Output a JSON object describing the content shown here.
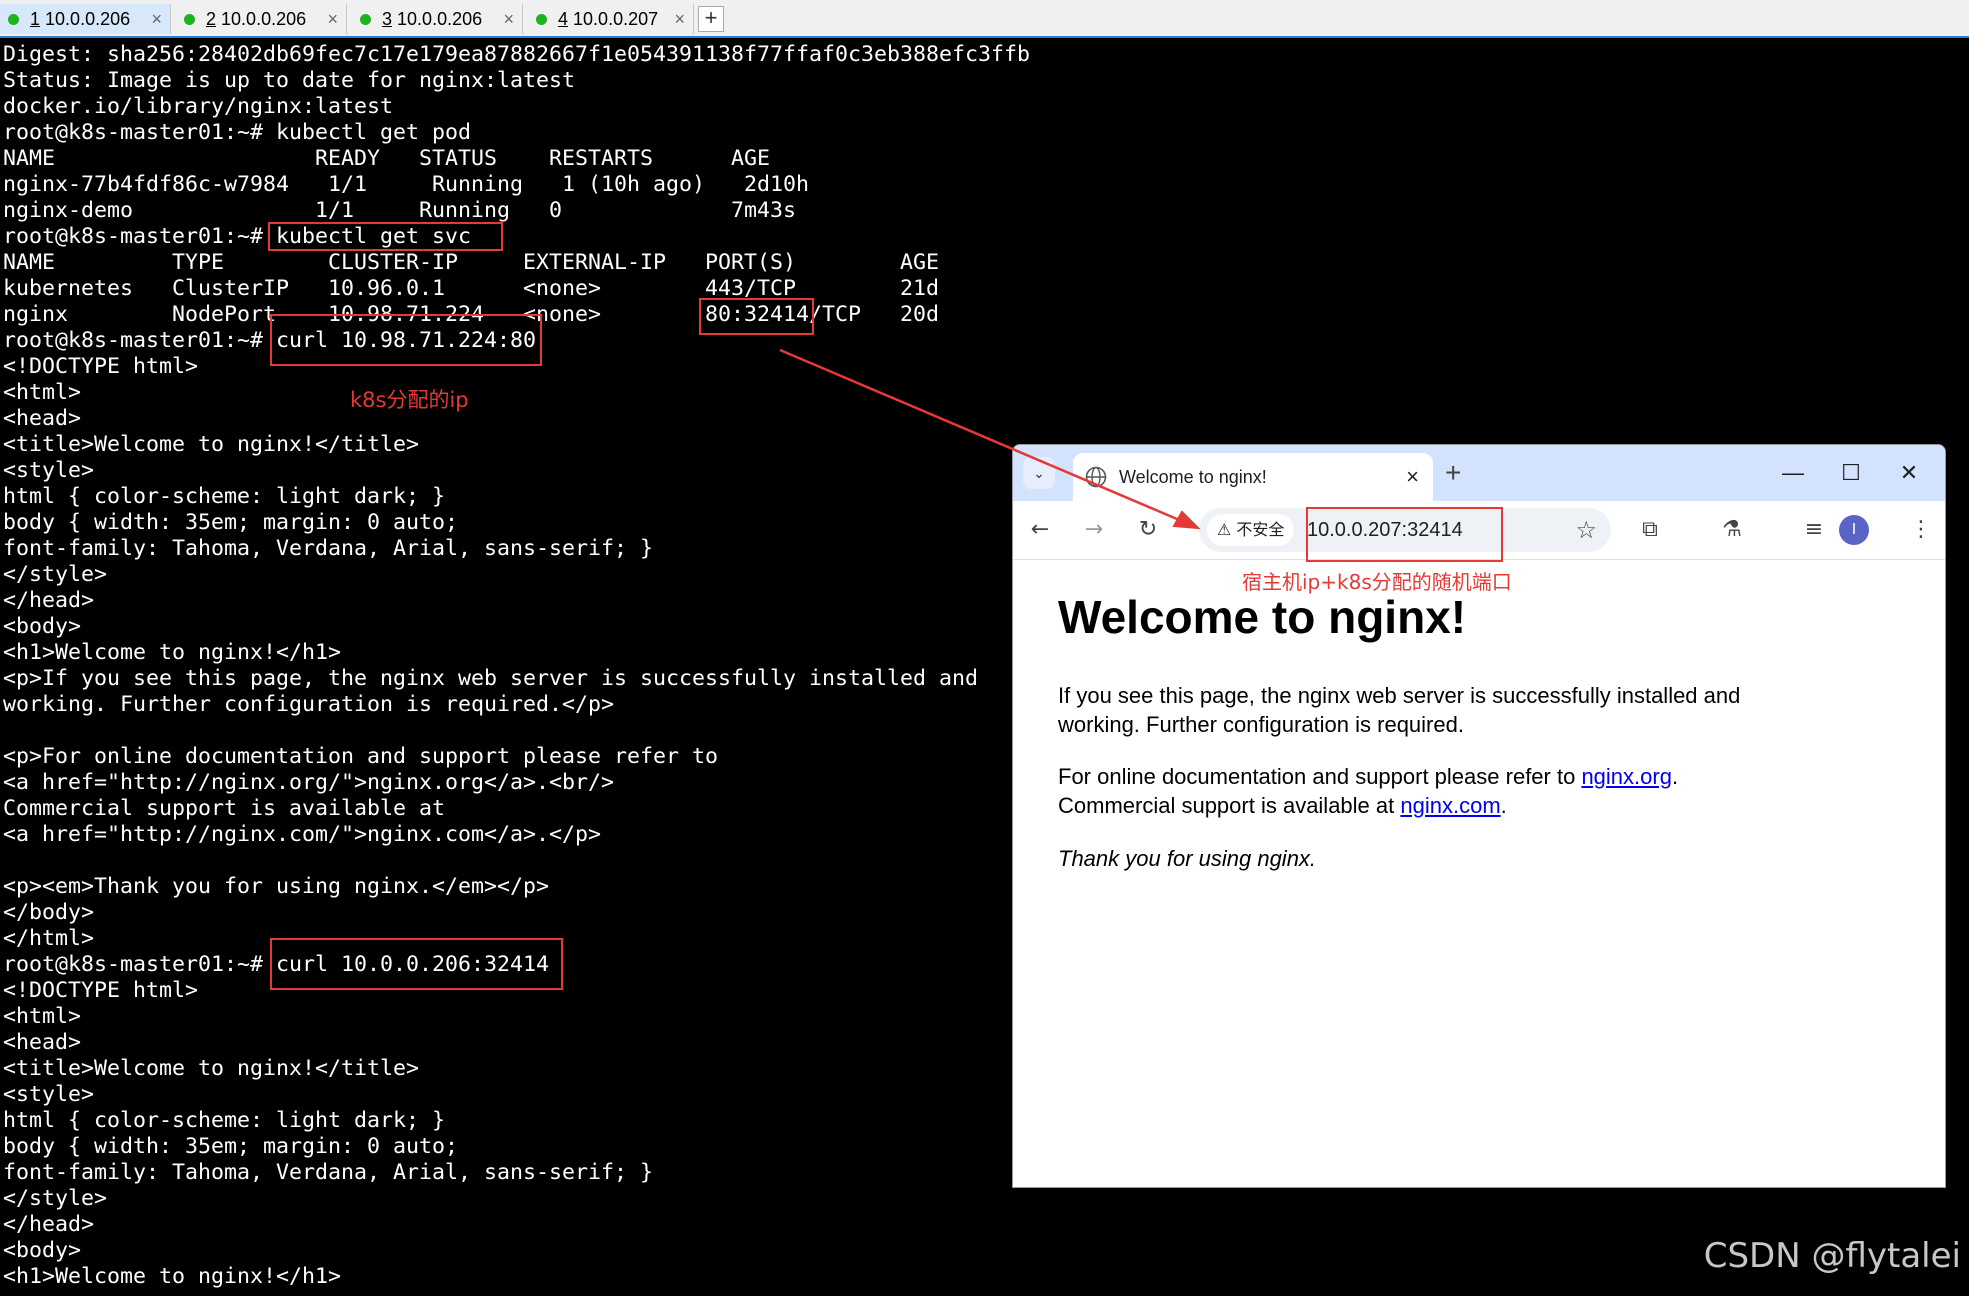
{
  "tabs": [
    {
      "num": "1",
      "host": "10.0.0.206",
      "active": true
    },
    {
      "num": "2",
      "host": "10.0.0.206",
      "active": false
    },
    {
      "num": "3",
      "host": "10.0.0.206",
      "active": false
    },
    {
      "num": "4",
      "host": "10.0.0.207",
      "active": false
    }
  ],
  "tab_close_glyph": "×",
  "tab_add_glyph": "+",
  "terminal": {
    "lines": [
      "Digest: sha256:28402db69fec7c17e179ea87882667f1e054391138f77ffaf0c3eb388efc3ffb",
      "Status: Image is up to date for nginx:latest",
      "docker.io/library/nginx:latest",
      "root@k8s-master01:~# kubectl get pod",
      "NAME                    READY   STATUS    RESTARTS      AGE",
      "nginx-77b4fdf86c-w7984   1/1     Running   1 (10h ago)   2d10h",
      "nginx-demo              1/1     Running   0             7m43s",
      "root@k8s-master01:~# kubectl get svc",
      "NAME         TYPE        CLUSTER-IP     EXTERNAL-IP   PORT(S)        AGE",
      "kubernetes   ClusterIP   10.96.0.1      <none>        443/TCP        21d",
      "nginx        NodePort    10.98.71.224   <none>        80:32414/TCP   20d",
      "root@k8s-master01:~# curl 10.98.71.224:80",
      "<!DOCTYPE html>",
      "<html>",
      "<head>",
      "<title>Welcome to nginx!</title>",
      "<style>",
      "html { color-scheme: light dark; }",
      "body { width: 35em; margin: 0 auto;",
      "font-family: Tahoma, Verdana, Arial, sans-serif; }",
      "</style>",
      "</head>",
      "<body>",
      "<h1>Welcome to nginx!</h1>",
      "<p>If you see this page, the nginx web server is successfully installed and",
      "working. Further configuration is required.</p>",
      "",
      "<p>For online documentation and support please refer to",
      "<a href=\"http://nginx.org/\">nginx.org</a>.<br/>",
      "Commercial support is available at",
      "<a href=\"http://nginx.com/\">nginx.com</a>.</p>",
      "",
      "<p><em>Thank you for using nginx.</em></p>",
      "</body>",
      "</html>",
      "root@k8s-master01:~# curl 10.0.0.206:32414",
      "<!DOCTYPE html>",
      "<html>",
      "<head>",
      "<title>Welcome to nginx!</title>",
      "<style>",
      "html { color-scheme: light dark; }",
      "body { width: 35em; margin: 0 auto;",
      "font-family: Tahoma, Verdana, Arial, sans-serif; }",
      "</style>",
      "</head>",
      "<body>",
      "<h1>Welcome to nginx!</h1>"
    ]
  },
  "annotations": {
    "k8s_ip": "k8s分配的ip",
    "host_port": "宿主机ip+k8s分配的随机端口",
    "color": "#e53935"
  },
  "browser": {
    "tab_title": "Welcome to nginx!",
    "tab_close": "×",
    "new_tab": "+",
    "tab_dropdown": "⌄",
    "window_buttons": {
      "minimize": "—",
      "maximize": "☐",
      "close": "✕"
    },
    "nav": {
      "back": "←",
      "forward": "→",
      "reload": "↻"
    },
    "security_label": "⚠ 不安全",
    "url": "10.0.0.207:32414",
    "bookmark_star": "☆",
    "extensions_icon": "⧉",
    "labs_icon": "⚗",
    "media_icon": "≡",
    "avatar_letter": "I",
    "menu_icon": "⋮",
    "page": {
      "heading": "Welcome to nginx!",
      "para1_line1": "If you see this page, the nginx web server is successfully installed and",
      "para1_line2": "working. Further configuration is required.",
      "para2_prefix": "For online documentation and support please refer to ",
      "para2_link1": "nginx.org",
      "para2_mid": ".",
      "para2_line2_prefix": "Commercial support is available at ",
      "para2_link2": "nginx.com",
      "para2_end": ".",
      "thanks": "Thank you for using nginx."
    }
  },
  "watermark": "CSDN @flytalei"
}
